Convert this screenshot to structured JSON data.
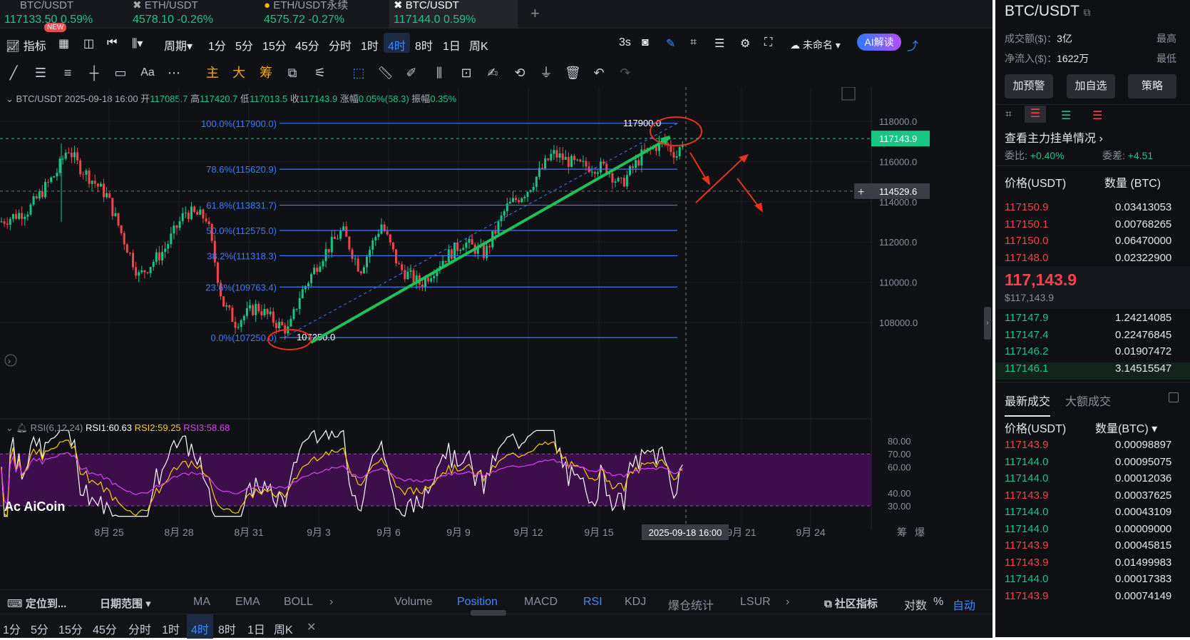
{
  "tabs": [
    {
      "pair": "BTC/USDT",
      "price": "117133.50",
      "change": "0.59%",
      "dir": "up",
      "badge": "NEW"
    },
    {
      "pair": "ETH/USDT",
      "price": "4578.10",
      "change": "-0.26%",
      "dir": "up"
    },
    {
      "pair": "ETH/USDT永续",
      "price": "4575.72",
      "change": "-0.27%",
      "dir": "up"
    },
    {
      "pair": "BTC/USDT",
      "price": "117144.0",
      "change": "0.59%",
      "dir": "up",
      "active": true
    }
  ],
  "toolbar": {
    "indicators": "指标",
    "period": "周期",
    "intervals": [
      "1分",
      "5分",
      "15分",
      "45分",
      "分时",
      "1时",
      "4时",
      "8时",
      "1日",
      "周K"
    ],
    "active_interval": "4时",
    "refresh": "3s",
    "layout_name": "未命名",
    "ai_button": "AI解读"
  },
  "draw_tools": {
    "text_tool": "Aa",
    "main": "主",
    "big": "大",
    "chips": "筹"
  },
  "ohlc": {
    "pair": "BTC/USDT",
    "time": "2025-09-18 16:00",
    "open_label": "开",
    "open": "117085.7",
    "high_label": "高",
    "high": "117420.7",
    "low_label": "低",
    "low": "117013.5",
    "close_label": "收",
    "close": "117143.9",
    "change_label": "涨幅",
    "change": "0.05%(58.3)",
    "amp_label": "振幅",
    "amp": "0.35%"
  },
  "fib_levels": [
    {
      "label": "100.0%(117900.0)",
      "value": 117900
    },
    {
      "label": "78.6%(115620.9)",
      "value": 115620.9
    },
    {
      "label": "61.8%(113831.7)",
      "value": 113831.7
    },
    {
      "label": "50.0%(112575.0)",
      "value": 112575
    },
    {
      "label": "38.2%(111318.3)",
      "value": 111318.3
    },
    {
      "label": "23.6%(109763.4)",
      "value": 109763.4
    },
    {
      "label": "0.0%(107250.0)",
      "value": 107250
    }
  ],
  "fib_marks": {
    "high": "117900.0",
    "low": "107250.0"
  },
  "price_axis": [
    "118000.0",
    "116000.0",
    "114000.0",
    "112000.0",
    "110000.0",
    "108000.0"
  ],
  "price_tags": {
    "current": "117143.9",
    "crosshair": "114529.6"
  },
  "rsi": {
    "label": "RSI(6,12,24)",
    "rsi1": "RSI1:60.63",
    "rsi2": "RSI2:59.25",
    "rsi3": "RSI3:58.68",
    "axis": [
      "80.00",
      "70.00",
      "60.00",
      "40.00",
      "30.00"
    ]
  },
  "time_axis": [
    "8月 25",
    "8月 28",
    "8月 31",
    "9月 3",
    "9月 6",
    "9月 9",
    "9月 12",
    "9月 15",
    "9月 21",
    "9月 24"
  ],
  "crosshair_time": "2025-09-18 16:00",
  "watermark": "AiCoin",
  "indicator_bar": {
    "locate": "定位到...",
    "date_range": "日期范围",
    "overlays": [
      "MA",
      "EMA",
      "BOLL"
    ],
    "subs": [
      "Volume",
      "Position",
      "MACD",
      "RSI",
      "KDJ",
      "爆仓统计",
      "LSUR"
    ],
    "community": "社区指标",
    "log": "对数",
    "pct": "%",
    "auto": "自动",
    "chips": "筹",
    "liq": "爆"
  },
  "bottom_intervals": [
    "1分",
    "5分",
    "15分",
    "45分",
    "分时",
    "1时",
    "4时",
    "8时",
    "1日",
    "周K"
  ],
  "side": {
    "pair": "BTC/USDT",
    "vol_label": "成交额($)：",
    "vol": "3亿",
    "net_label": "净流入($)：",
    "net": "1622万",
    "high_label": "最高",
    "low_label": "最低",
    "buttons": [
      "加预警",
      "加自选",
      "策略"
    ],
    "orders_title": "查看主力挂单情况",
    "ratio_label": "委比:",
    "ratio": "+0.40%",
    "diff_label": "委差:",
    "diff": "+4.51",
    "book_header": [
      "价格(USDT)",
      "数量 (BTC)"
    ],
    "asks": [
      [
        "117150.9",
        "0.03413053"
      ],
      [
        "117150.1",
        "0.00768265"
      ],
      [
        "117150.0",
        "0.06470000"
      ],
      [
        "117148.0",
        "0.02322900"
      ]
    ],
    "mid_price": "117,143.9",
    "mid_usd": "$117,143.9",
    "bids": [
      [
        "117147.9",
        "1.24214085"
      ],
      [
        "117147.4",
        "0.22476845"
      ],
      [
        "117146.2",
        "0.01907472"
      ],
      [
        "117146.1",
        "3.14515547"
      ]
    ],
    "trade_tabs": [
      "最新成交",
      "大额成交"
    ],
    "trade_header": [
      "价格(USDT)",
      "数量(BTC)"
    ],
    "trades": [
      [
        "117143.9",
        "0.00098897",
        "sell"
      ],
      [
        "117144.0",
        "0.00095075",
        "buy"
      ],
      [
        "117144.0",
        "0.00012036",
        "buy"
      ],
      [
        "117143.9",
        "0.00037625",
        "sell"
      ],
      [
        "117144.0",
        "0.00043109",
        "buy"
      ],
      [
        "117144.0",
        "0.00009000",
        "buy"
      ],
      [
        "117143.9",
        "0.00045815",
        "sell"
      ],
      [
        "117143.9",
        "0.01499983",
        "sell"
      ],
      [
        "117144.0",
        "0.00017383",
        "buy"
      ],
      [
        "117143.9",
        "0.00074149",
        "sell"
      ]
    ]
  },
  "colors": {
    "up": "#16c784",
    "down": "#f0454b",
    "accent": "#3d8bff",
    "fib": "#3d7bff",
    "rsi1": "#ffffff",
    "rsi2": "#f5d000",
    "rsi3": "#e040fb",
    "annotation": "#e8321e"
  }
}
